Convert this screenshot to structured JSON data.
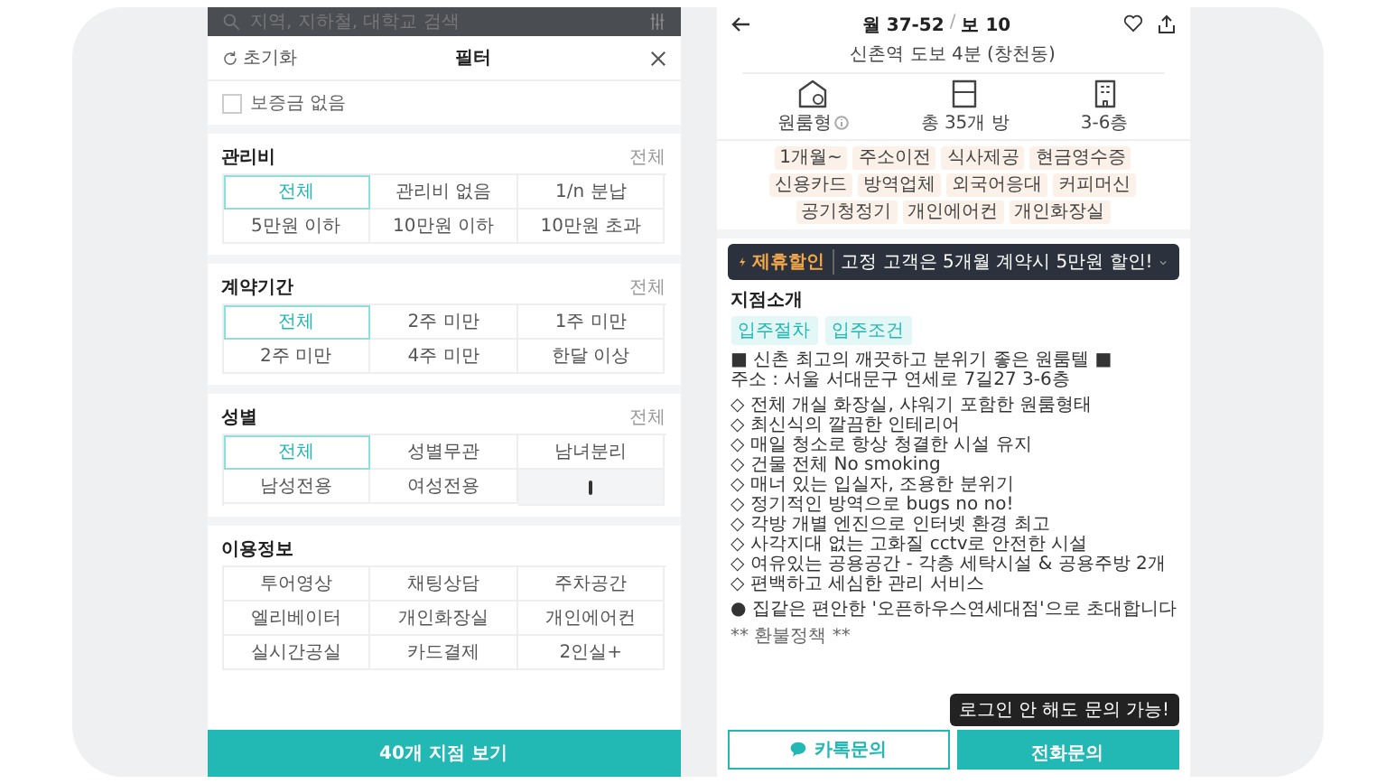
{
  "background_screen": {
    "search_placeholder": "지역, 지하철, 대학교 검색"
  },
  "filter": {
    "reset": "초기화",
    "title": "필터",
    "no_deposit": {
      "label": "보증금 없음",
      "checked": false
    },
    "sections": [
      {
        "title": "관리비",
        "all_link": "전체",
        "options": [
          {
            "kind": "text",
            "label": "전체",
            "selected": true
          },
          {
            "kind": "text",
            "label": "관리비 없음",
            "selected": false
          },
          {
            "kind": "text",
            "label": "1/n 분납",
            "selected": false
          },
          {
            "kind": "text",
            "label": "5만원 이하",
            "selected": false
          },
          {
            "kind": "text",
            "label": "10만원 이하",
            "selected": false
          },
          {
            "kind": "text",
            "label": "10만원 초과",
            "selected": false
          }
        ]
      },
      {
        "title": "계약기간",
        "all_link": "전체",
        "options": [
          {
            "kind": "text",
            "label": "전체",
            "selected": true
          },
          {
            "kind": "text",
            "label": "2주 미만",
            "selected": false
          },
          {
            "kind": "text",
            "label": "1주 미만",
            "selected": false
          },
          {
            "kind": "text",
            "label": "2주 미만",
            "selected": false
          },
          {
            "kind": "text",
            "label": "4주 미만",
            "selected": false
          },
          {
            "kind": "text",
            "label": "한달 이상",
            "selected": false
          }
        ]
      },
      {
        "title": "성별",
        "all_link": "전체",
        "options": [
          {
            "kind": "text",
            "label": "전체",
            "selected": true
          },
          {
            "kind": "text",
            "label": "성별무관",
            "selected": false
          },
          {
            "kind": "text",
            "label": "남녀분리",
            "selected": false
          },
          {
            "kind": "text",
            "label": "남성전용",
            "selected": false
          },
          {
            "kind": "text",
            "label": "여성전용",
            "selected": false
          },
          {
            "kind": "icon",
            "selected": false
          }
        ]
      },
      {
        "title": "이용정보",
        "options": [
          {
            "kind": "text",
            "label": "투어영상",
            "selected": false
          },
          {
            "kind": "text",
            "label": "채팅상담",
            "selected": false
          },
          {
            "kind": "text",
            "label": "주차공간",
            "selected": false
          },
          {
            "kind": "text",
            "label": "엘리베이터",
            "selected": false
          },
          {
            "kind": "text",
            "label": "개인화장실",
            "selected": false
          },
          {
            "kind": "text",
            "label": "개인에어컨",
            "selected": false
          },
          {
            "kind": "text",
            "label": "실시간공실",
            "selected": false
          },
          {
            "kind": "text",
            "label": "카드결제",
            "selected": false
          },
          {
            "kind": "text",
            "label": "2인실+",
            "selected": false
          }
        ]
      }
    ],
    "apply_button": "40개 지점 보기"
  },
  "detail": {
    "price": "월 37-52",
    "separator": "/",
    "deposit": "보 10",
    "liked": false,
    "location": "신촌역 도보 4분 (창천동)",
    "facts": [
      {
        "kind": "room",
        "label": "원룸형",
        "info": true
      },
      {
        "kind": "rooms",
        "label": "총 35개 방",
        "info": false
      },
      {
        "kind": "floors",
        "label": "3-6층",
        "info": false
      }
    ],
    "tags": [
      "1개월~",
      "주소이전",
      "식사제공",
      "현금영수증",
      "신용카드",
      "방역업체",
      "외국어응대",
      "커피머신",
      "공기청정기",
      "개인에어컨",
      "개인화장실"
    ],
    "promo": {
      "badge": "제휴할인",
      "text": "고정 고객은 5개월 계약시 5만원 할인!",
      "expanded": false
    },
    "intro_title": "지점소개",
    "intro_tabs": [
      "입주절차",
      "입주조건"
    ],
    "description_blocks": [
      [
        "■ 신촌 최고의 깨끗하고 분위기 좋은 원룸텔 ■",
        "주소 : 서울 서대문구 연세로 7길27 3-6층"
      ],
      [
        "◇ 전체 개실 화장실, 샤워기 포함한 원룸형태",
        "◇ 최신식의 깔끔한 인테리어",
        "◇ 매일 청소로 항상 청결한 시설 유지",
        "◇ 건물 전체 No smoking",
        "◇ 매너 있는 입실자, 조용한 분위기",
        "◇ 정기적인 방역으로 bugs no no!",
        "◇ 각방 개별 엔진으로 인터넷 환경 최고",
        "◇ 사각지대 없는 고화질 cctv로 안전한 시설",
        "◇ 여유있는 공용공간 - 각층 세탁시설 & 공용주방 2개",
        "◇ 편백하고 세심한 관리 서비스"
      ],
      [
        "● 집같은 편안한 '오픈하우스연세대점'으로 초대합니다"
      ]
    ],
    "refund_policy": "** 환불정책 **",
    "tooltip": "로그인 안 해도 문의 가능!",
    "buttons": [
      {
        "kind": "chat",
        "label": "카톡문의"
      },
      {
        "kind": "phone",
        "label": "전화문의"
      }
    ]
  }
}
